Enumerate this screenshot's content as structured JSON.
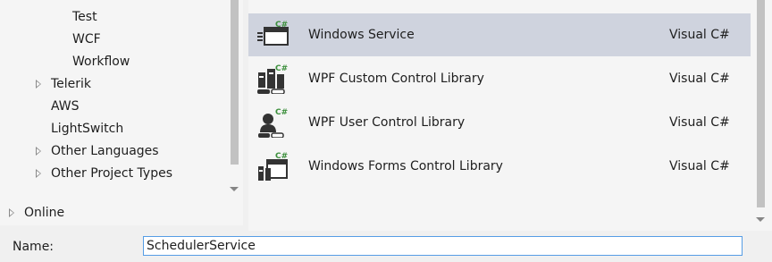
{
  "left_tree": {
    "items": [
      {
        "label": "Test",
        "expandable": false
      },
      {
        "label": "WCF",
        "expandable": false
      },
      {
        "label": "Workflow",
        "expandable": false
      },
      {
        "label": "Telerik",
        "expandable": true
      },
      {
        "label": "AWS",
        "expandable": false
      },
      {
        "label": "LightSwitch",
        "expandable": false
      },
      {
        "label": "Other Languages",
        "expandable": true
      },
      {
        "label": "Other Project Types",
        "expandable": true
      }
    ],
    "online": "Online"
  },
  "templates": {
    "icon_badge": "C#",
    "rows": [
      {
        "name": "Windows Service",
        "language": "Visual C#",
        "selected": true,
        "icon": "windows-service-icon"
      },
      {
        "name": "WPF Custom Control Library",
        "language": "Visual C#",
        "selected": false,
        "icon": "wpf-custom-control-icon"
      },
      {
        "name": "WPF User Control Library",
        "language": "Visual C#",
        "selected": false,
        "icon": "wpf-user-control-icon"
      },
      {
        "name": "Windows Forms Control Library",
        "language": "Visual C#",
        "selected": false,
        "icon": "winforms-control-icon"
      }
    ]
  },
  "form": {
    "name_label": "Name:",
    "name_value": "SchedulerService"
  },
  "colors": {
    "selection": "#cfd3de",
    "badge_green": "#3c8f3c",
    "input_border": "#569de5"
  }
}
